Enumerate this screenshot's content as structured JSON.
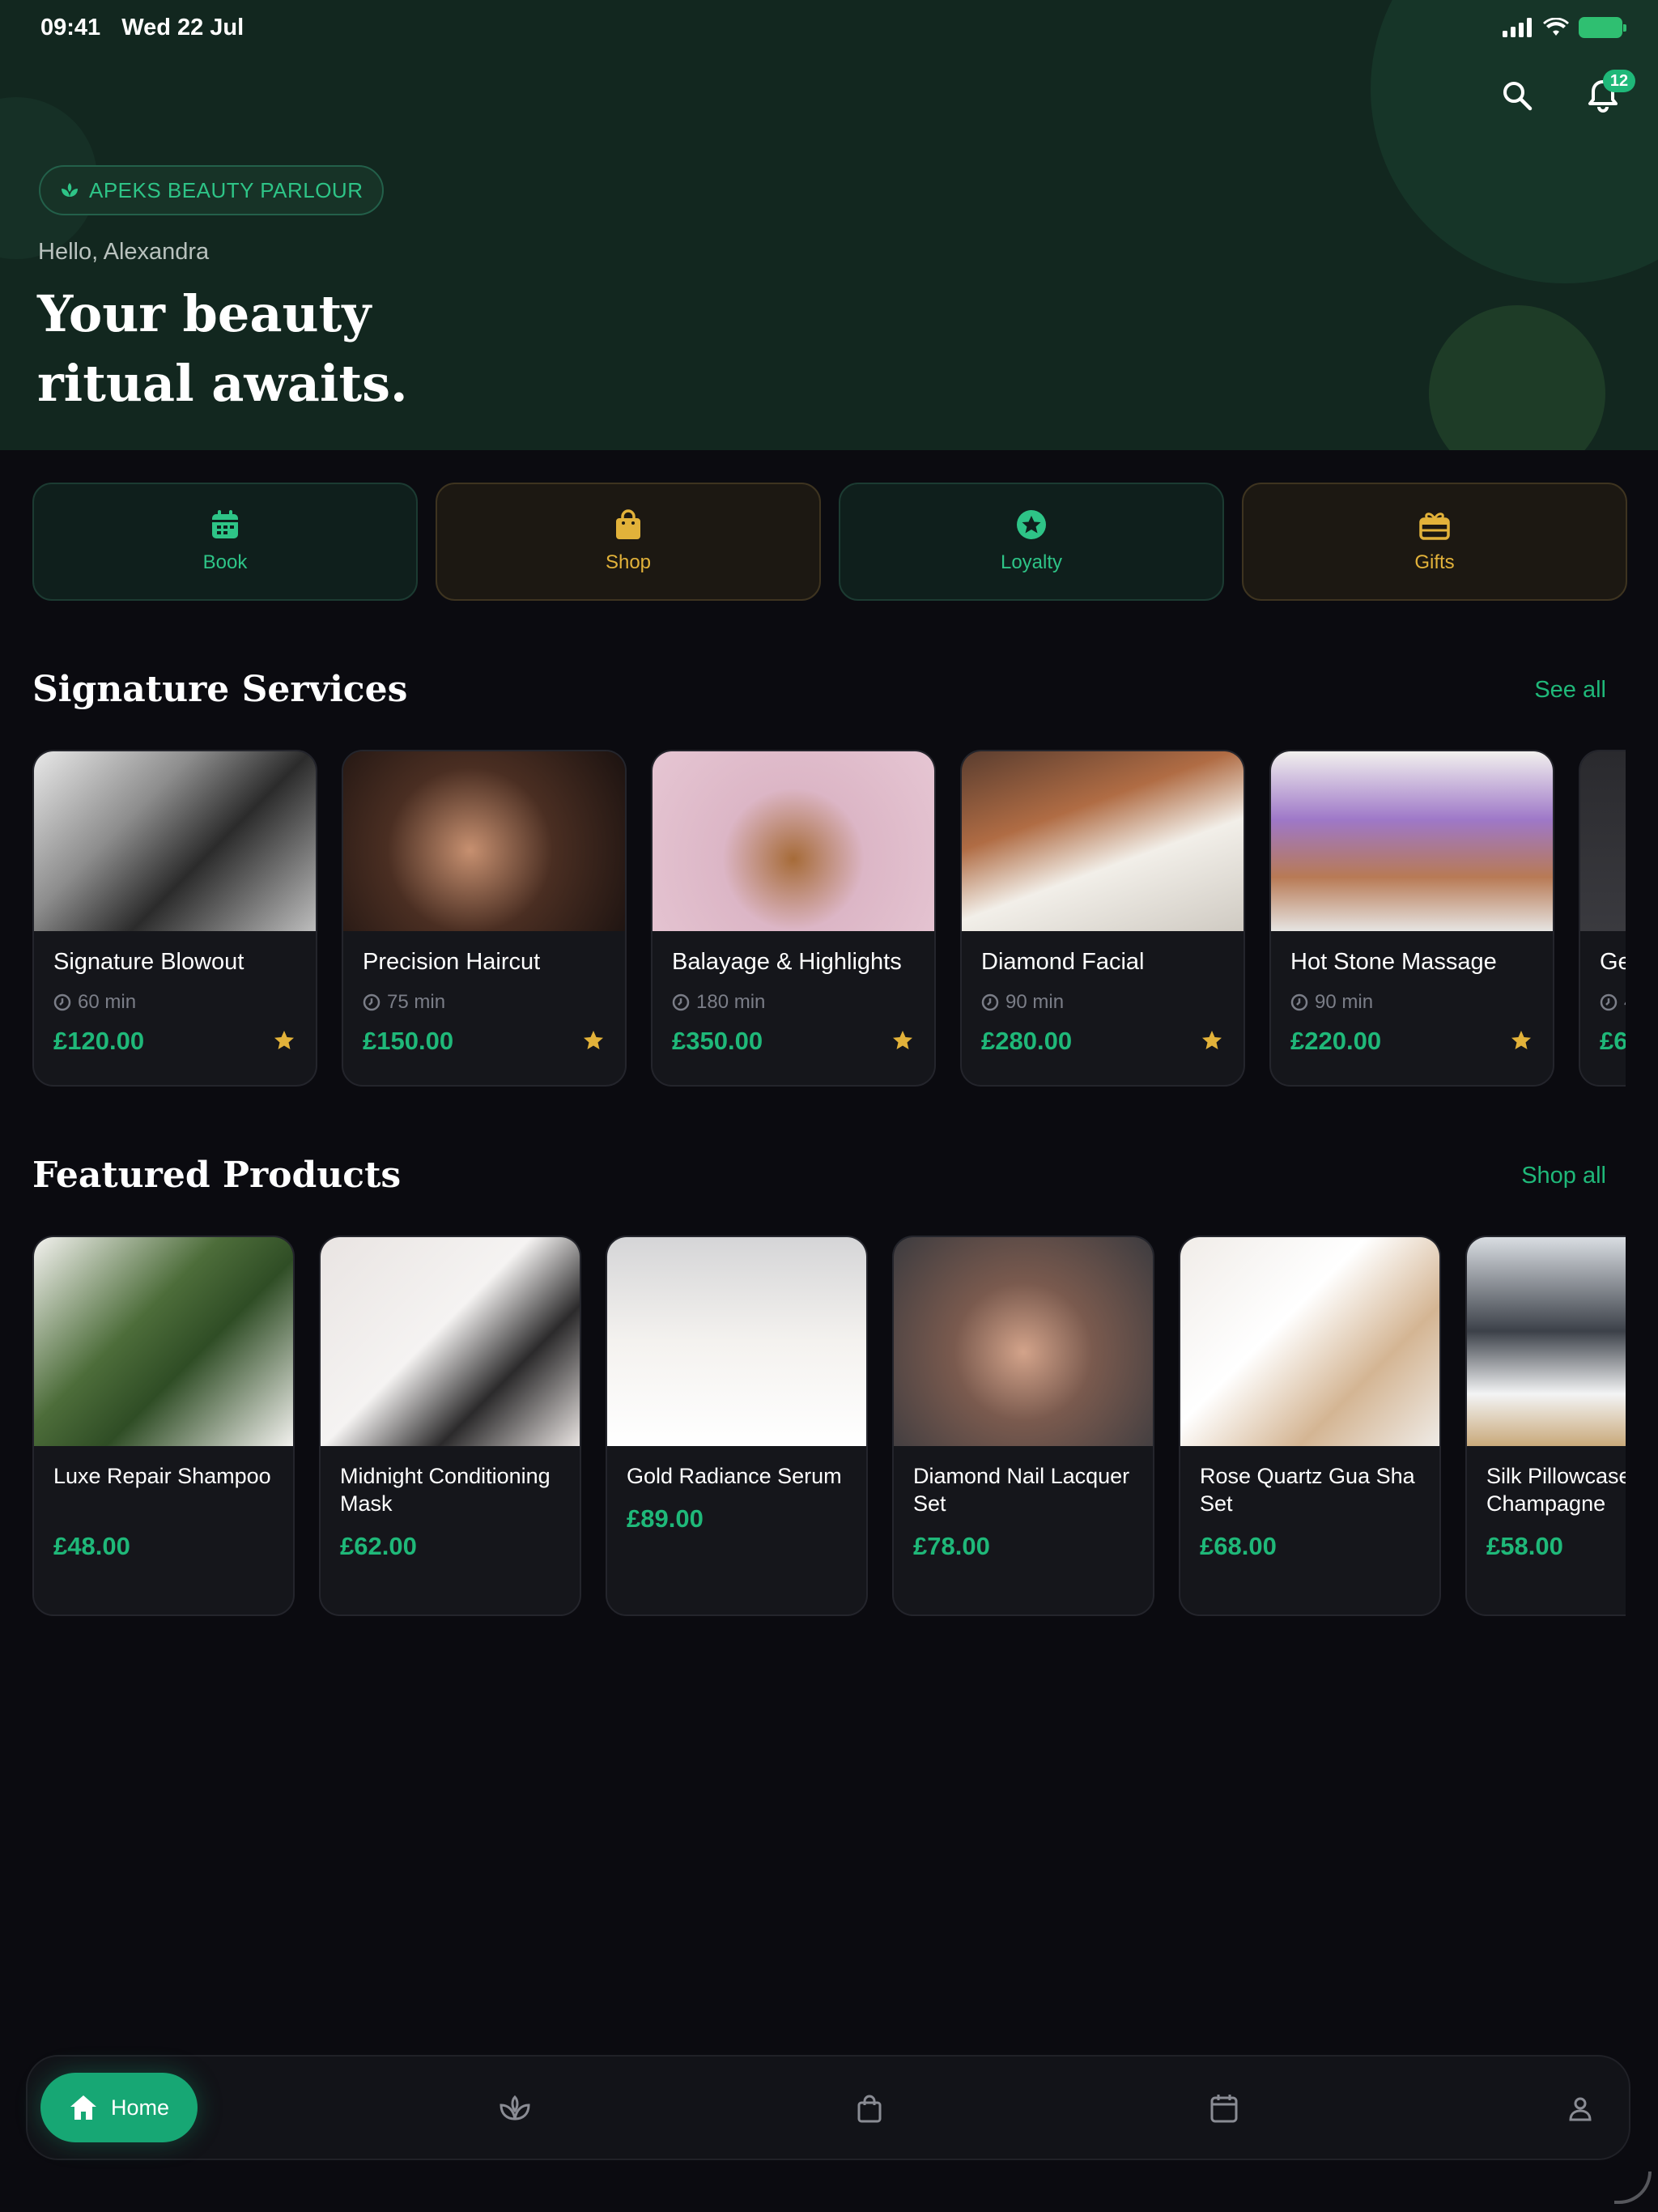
{
  "status_bar": {
    "time": "09:41",
    "date": "Wed 22 Jul"
  },
  "header": {
    "brand": "APEKS BEAUTY PARLOUR",
    "greeting": "Hello, Alexandra",
    "headline": "Your beauty ritual awaits.",
    "notifications_count": "12",
    "icons": {
      "search": "search-icon",
      "bell": "bell-icon"
    }
  },
  "quick_actions": [
    {
      "label": "Book",
      "icon": "calendar-icon",
      "color": "#2ec487"
    },
    {
      "label": "Shop",
      "icon": "shopping-bag-icon",
      "color": "#e2b23a"
    },
    {
      "label": "Loyalty",
      "icon": "star-badge-icon",
      "color": "#2ec487"
    },
    {
      "label": "Gifts",
      "icon": "gift-icon",
      "color": "#e2b23a"
    }
  ],
  "services_section": {
    "title": "Signature Services",
    "link": "See all",
    "items": [
      {
        "name": "Signature Blowout",
        "duration": "60 min",
        "price": "£120.00"
      },
      {
        "name": "Precision Haircut",
        "duration": "75 min",
        "price": "£150.00"
      },
      {
        "name": "Balayage & Highlights",
        "duration": "180 min",
        "price": "£350.00"
      },
      {
        "name": "Diamond Facial",
        "duration": "90 min",
        "price": "£280.00"
      },
      {
        "name": "Hot Stone Massage",
        "duration": "90 min",
        "price": "£220.00"
      },
      {
        "name": "Ge",
        "duration": "4",
        "price": "£6"
      }
    ]
  },
  "products_section": {
    "title": "Featured Products",
    "link": "Shop all",
    "items": [
      {
        "name": "Luxe Repair Shampoo",
        "price": "£48.00"
      },
      {
        "name": "Midnight Conditioning Mask",
        "price": "£62.00"
      },
      {
        "name": "Gold Radiance Serum",
        "price": "£89.00"
      },
      {
        "name": "Diamond Nail Lacquer Set",
        "price": "£78.00"
      },
      {
        "name": "Rose Quartz Gua Sha Set",
        "price": "£68.00"
      },
      {
        "name": "Silk Pillowcase Champagne",
        "price": "£58.00"
      }
    ]
  },
  "bottom_nav": {
    "active_label": "Home",
    "items": [
      "home-icon",
      "lotus-icon",
      "shopping-bag-icon",
      "calendar-icon",
      "profile-icon"
    ]
  },
  "colors": {
    "accent": "#1fb879",
    "gold": "#e2b23a",
    "header_bg": "#12271f",
    "page_bg": "#0b0b10"
  }
}
